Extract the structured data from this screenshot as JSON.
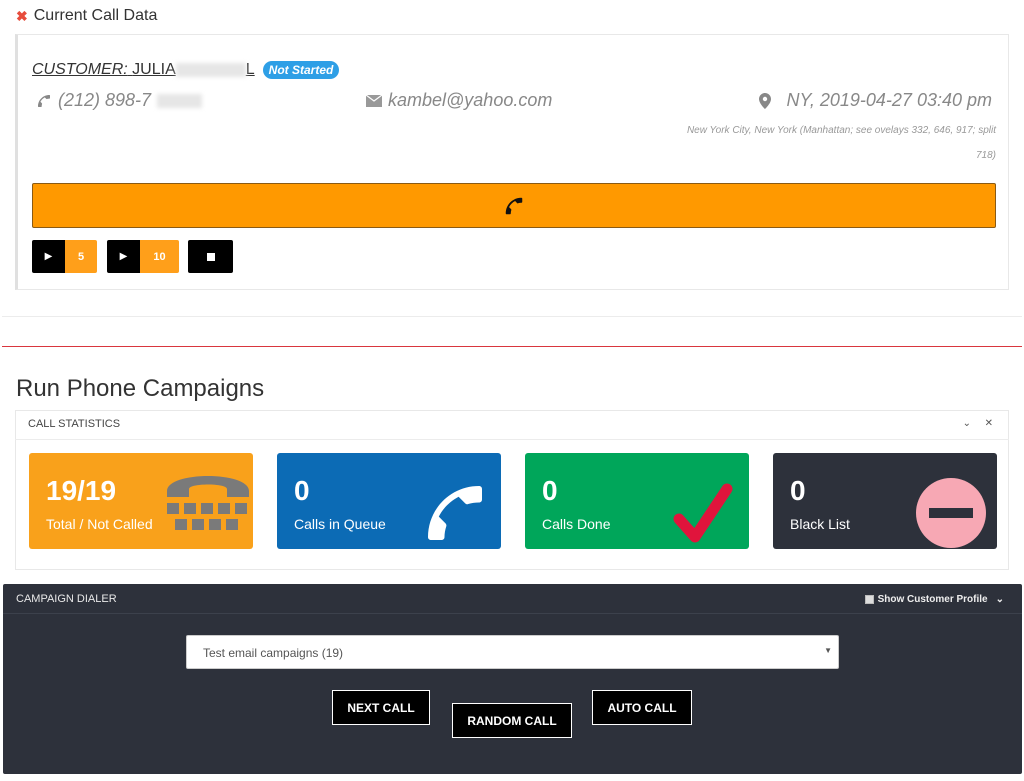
{
  "current_call": {
    "title": "Current Call Data",
    "customer_label": "CUSTOMER:",
    "customer_name_visible": "JULIA",
    "customer_name_suffix": "L",
    "status_badge": "Not Started",
    "phone_visible": "(212) 898-7",
    "email": "kambel@yahoo.com",
    "location_datetime": "NY, 2019-04-27 03:40 pm",
    "location_detail": "New York City, New York (Manhattan; see ovelays 332, 646, 917; split 718)",
    "timer_buttons": [
      {
        "value": "5"
      },
      {
        "value": "10"
      }
    ]
  },
  "campaigns": {
    "title": "Run Phone Campaigns",
    "stats_panel": {
      "title": "CALL STATISTICS",
      "cards": [
        {
          "value": "19/19",
          "label": "Total / Not Called",
          "color": "#f9a11b"
        },
        {
          "value": "0",
          "label": "Calls in Queue",
          "color": "#0c6bb5"
        },
        {
          "value": "0",
          "label": "Calls Done",
          "color": "#00a65a"
        },
        {
          "value": "0",
          "label": "Black List",
          "color": "#2d313b"
        }
      ]
    },
    "dialer": {
      "title": "CAMPAIGN DIALER",
      "show_profile_label": "Show Customer Profile",
      "selected_campaign": "Test email campaigns (19)",
      "buttons": {
        "next": "NEXT CALL",
        "random": "RANDOM CALL",
        "auto": "AUTO CALL"
      }
    }
  }
}
